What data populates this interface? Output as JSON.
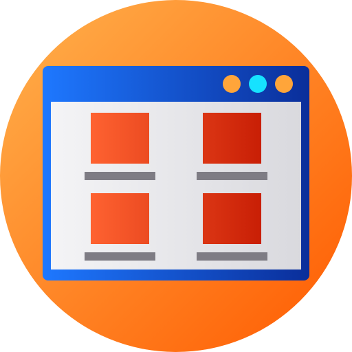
{
  "icon": {
    "name": "browser-window-grid-icon",
    "colors": {
      "badge_light": "#FFB24D",
      "badge_dark": "#FF5A00",
      "frame_left": "#1E78FF",
      "frame_right": "#0A2E9A",
      "content_left": "#F4F4F6",
      "content_right": "#D9D9DE",
      "tile_left": "#FF6331",
      "tile_right": "#C81E05",
      "caption_bar": "#7E7C84",
      "dot_orange": "#FFA53A",
      "dot_cyan": "#16E2FF"
    },
    "window_controls": [
      "orange-dot",
      "cyan-dot",
      "orange-dot"
    ],
    "grid": {
      "rows": 2,
      "columns": 2,
      "items": [
        {
          "tile": "tile",
          "caption": "caption-bar"
        },
        {
          "tile": "tile",
          "caption": "caption-bar"
        },
        {
          "tile": "tile",
          "caption": "caption-bar"
        },
        {
          "tile": "tile",
          "caption": "caption-bar"
        }
      ]
    }
  }
}
